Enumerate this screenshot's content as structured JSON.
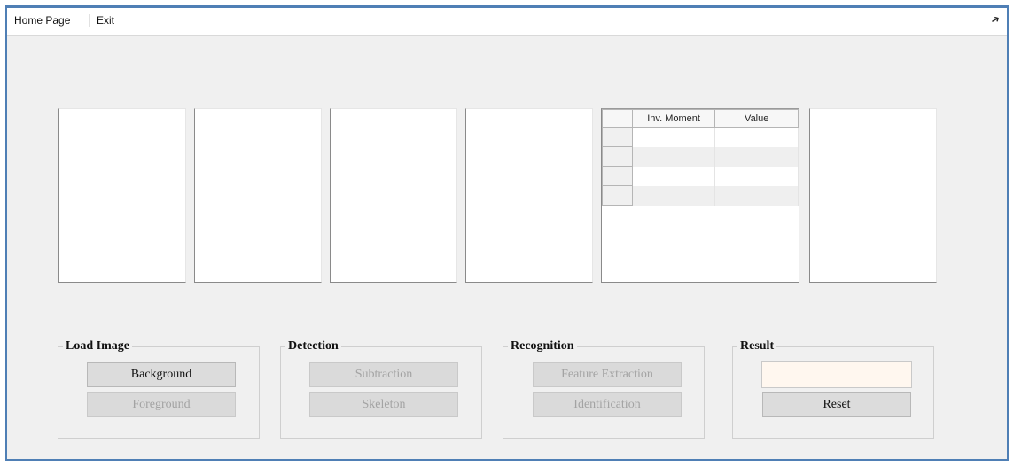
{
  "menu": {
    "home_page": "Home Page",
    "exit": "Exit",
    "pin_icon": "pin-icon"
  },
  "grid": {
    "columns": [
      "Inv. Moment",
      "Value"
    ],
    "rows": [
      {
        "moment": "",
        "value": ""
      },
      {
        "moment": "",
        "value": ""
      },
      {
        "moment": "",
        "value": ""
      },
      {
        "moment": "",
        "value": ""
      }
    ]
  },
  "groups": {
    "load_image": {
      "title": "Load Image",
      "background_label": "Background",
      "foreground_label": "Foreground"
    },
    "detection": {
      "title": "Detection",
      "subtraction_label": "Subtraction",
      "skeleton_label": "Skeleton"
    },
    "recognition": {
      "title": "Recognition",
      "feature_extraction_label": "Feature Extraction",
      "identification_label": "Identification"
    },
    "result": {
      "title": "Result",
      "value": "",
      "reset_label": "Reset"
    }
  },
  "colors": {
    "window_border": "#4f7fb5",
    "form_background": "#f0f0f0",
    "result_box": "#fff7ef"
  }
}
